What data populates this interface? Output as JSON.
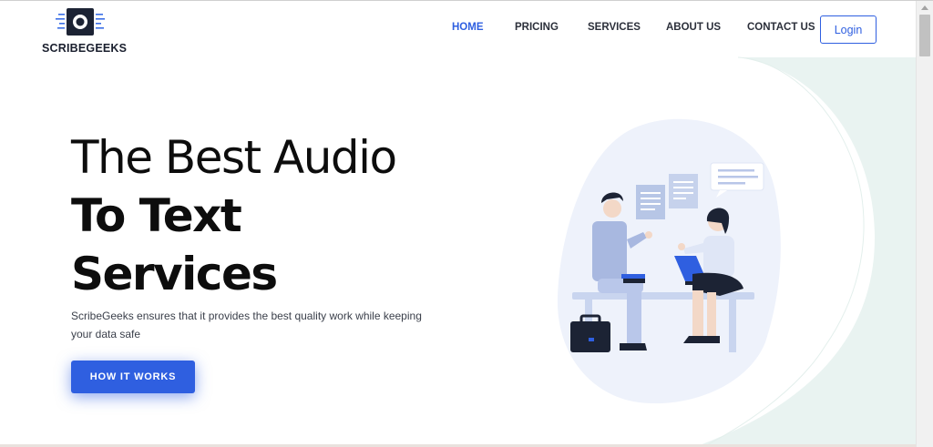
{
  "brand": {
    "name": "SCRIBEGEEKS",
    "logo_icon": "audio-recorder-icon"
  },
  "nav": {
    "items": [
      {
        "label": "HOME",
        "active": true
      },
      {
        "label": "PRICING",
        "active": false
      },
      {
        "label": "SERVICES",
        "active": false
      },
      {
        "label": "ABOUT US",
        "active": false
      },
      {
        "label": "CONTACT US",
        "active": false
      }
    ],
    "login_label": "Login"
  },
  "hero": {
    "title_line1_light": "The Best ",
    "title_line1_bold": "Audio",
    "title_line2": "To Text",
    "title_line3": "Services",
    "subtitle": "ScribeGeeks ensures that it provides the best quality work while keeping your data safe",
    "cta_label": "HOW IT WORKS"
  },
  "colors": {
    "accent": "#2f5fe0",
    "blob": "#e9f3f1",
    "illustration_bg": "#eef2fb",
    "text_dark": "#0d0d0d"
  },
  "illustration": {
    "icon": "two-people-conversation-icon"
  }
}
